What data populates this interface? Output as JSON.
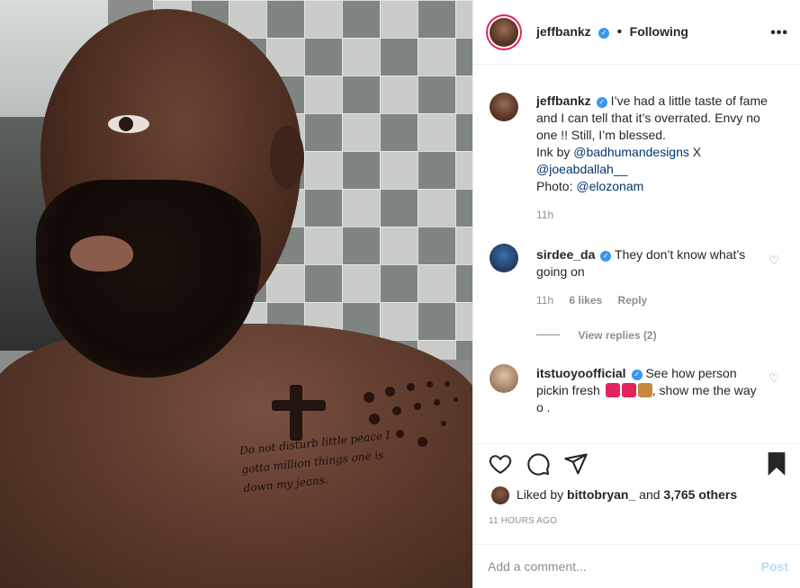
{
  "post": {
    "author": "jeffbankz",
    "follow_status": "Following",
    "more_icon": "more-horizontal-icon",
    "caption": {
      "username": "jeffbankz",
      "text_1": "I’ve had a little taste of fame and I can tell that it’s overrated. Envy no one !! Still, I’m blessed.",
      "ink_prefix": "Ink by",
      "mention_1": "@badhumandesigns",
      "ink_joiner": " X",
      "mention_2": "@joeabdallah__",
      "photo_prefix": "Photo:",
      "mention_3": "@elozonam",
      "time": "11h"
    },
    "tattoo_text": "Do not disturb little peace I gotta million things one is down my jeans.",
    "comments": [
      {
        "username": "sirdee_da",
        "text": "They don’t know what’s going on",
        "time": "11h",
        "likes": "6 likes",
        "reply_label": "Reply",
        "view_replies": "View replies (2)"
      },
      {
        "username": "itstuoyoofficial",
        "text_1": "See how person pickin fresh",
        "text_2": ", show me the way o .",
        "emoji_colors": [
          "#e0245e",
          "#e0245e",
          "#c8873d"
        ]
      }
    ],
    "liked_by": {
      "prefix": "Liked by",
      "user": "bittobryan_",
      "joiner": "and",
      "count": "3,765 others"
    },
    "timestamp": "11 HOURS AGO",
    "add_comment_placeholder": "Add a comment...",
    "post_label": "Post"
  },
  "colors": {
    "link": "#00376b",
    "verified": "#3897f0",
    "muted": "#8e8e8e",
    "post_disabled": "#b2dffc"
  }
}
